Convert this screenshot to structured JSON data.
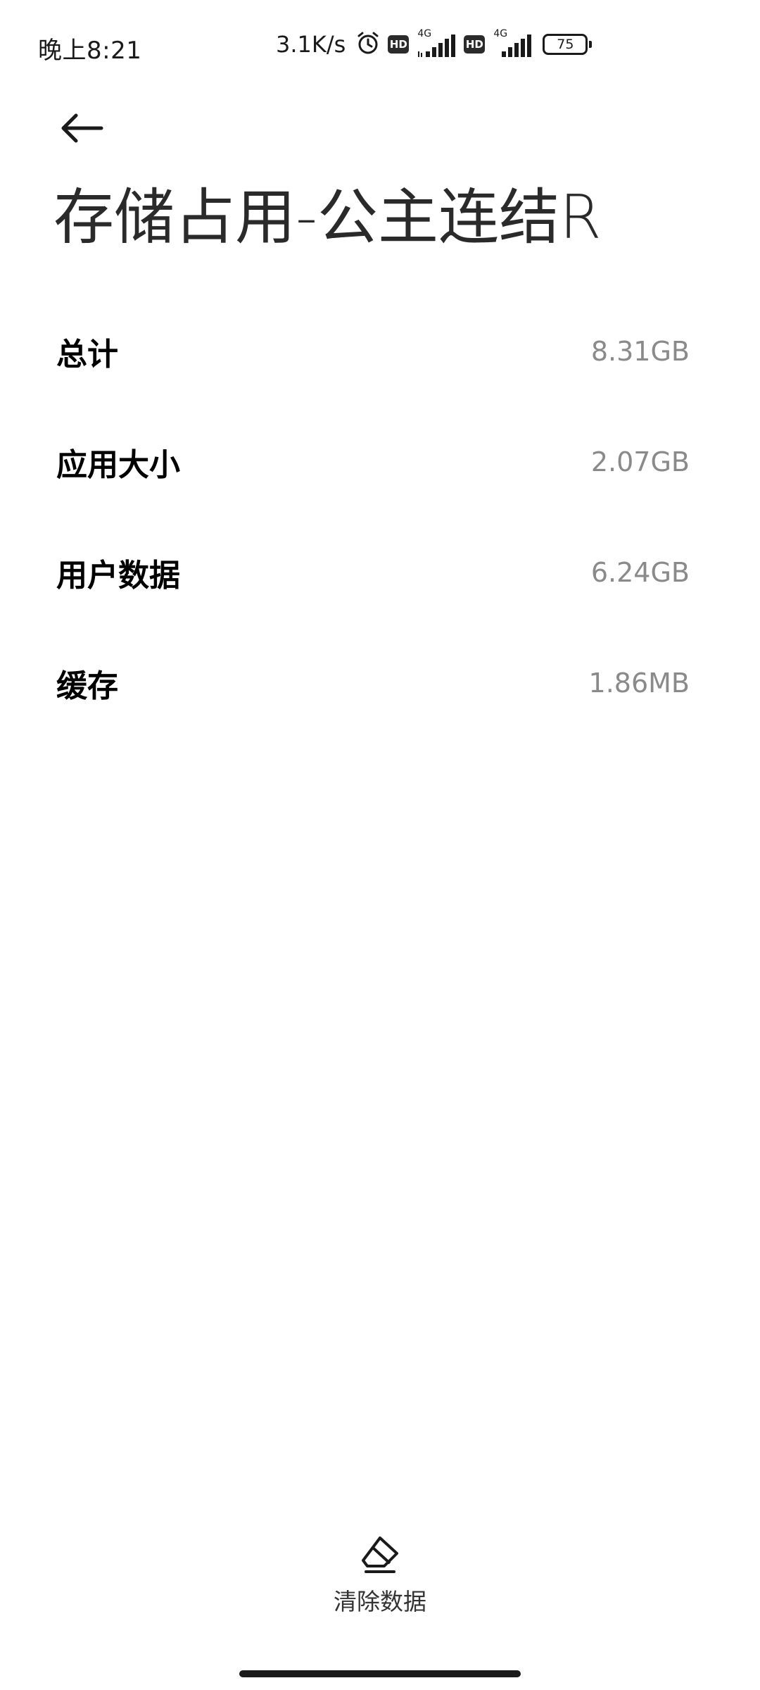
{
  "status_bar": {
    "time": "晚上8:21",
    "net_speed": "3.1K/s",
    "sim1_hd": "HD",
    "sim1_type": "4G",
    "sim2_hd": "HD",
    "sim2_type": "4G",
    "battery": "75",
    "icons": [
      "alarm-icon",
      "signal-icon",
      "battery-icon"
    ]
  },
  "header": {
    "back_icon": "arrow-left-icon",
    "title": "存储占用-公主连结R"
  },
  "storage": {
    "rows": [
      {
        "label": "总计",
        "value": "8.31GB"
      },
      {
        "label": "应用大小",
        "value": "2.07GB"
      },
      {
        "label": "用户数据",
        "value": "6.24GB"
      },
      {
        "label": "缓存",
        "value": "1.86MB"
      }
    ]
  },
  "footer": {
    "clear_icon": "eraser-icon",
    "clear_label": "清除数据"
  },
  "colors": {
    "background": "#ffffff",
    "label": "#000000",
    "value": "#8a8a8a",
    "title": "#2a2a2a"
  }
}
